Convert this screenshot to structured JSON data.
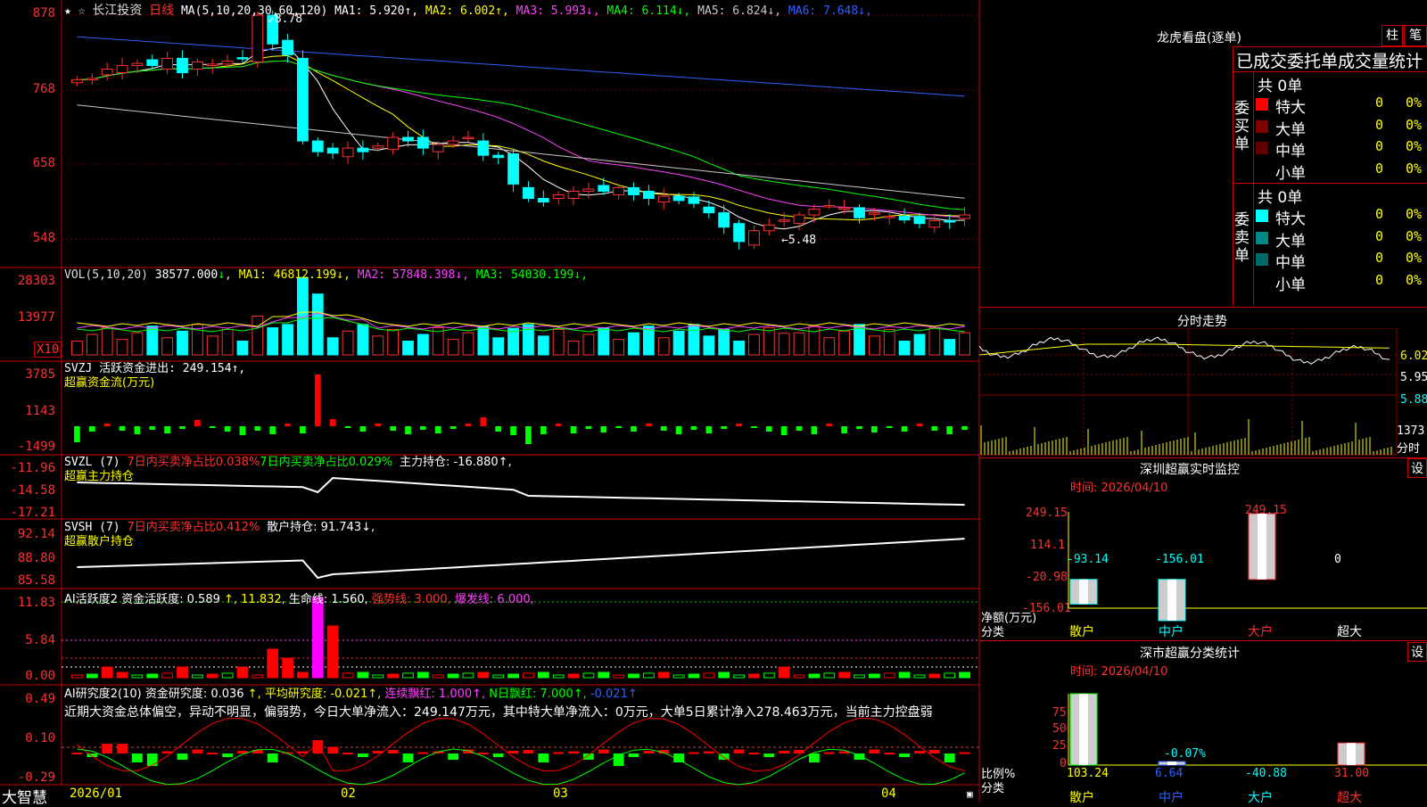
{
  "app": {
    "logo": "大智慧",
    "stock_name": "长江投资",
    "period": "日线"
  },
  "main_header": {
    "ma_label": "MA(5,10,20,30,60,120)",
    "items": [
      {
        "label": "MA1: 5.920",
        "arrow": "↑",
        "color": "#ffffff"
      },
      {
        "label": "MA2: 6.002",
        "arrow": "↑",
        "color": "#ffff00"
      },
      {
        "label": "MA3: 5.993",
        "arrow": "↓",
        "color": "#ff40ff"
      },
      {
        "label": "MA4: 6.114",
        "arrow": "↓",
        "color": "#00ff00"
      },
      {
        "label": "MA5: 6.824",
        "arrow": "↓",
        "color": "#c8c8c8"
      },
      {
        "label": "MA6: 7.648",
        "arrow": "↓",
        "color": "#3060ff"
      }
    ],
    "high_mark": "8.78",
    "low_mark": "5.48"
  },
  "vol_header": {
    "label": "VOL(5,10,20)",
    "value": "38577.000",
    "value_arrow": "↓",
    "items": [
      {
        "label": "MA1: 46812.199",
        "arrow": "↓",
        "color": "#ffff00"
      },
      {
        "label": "MA2: 57848.398",
        "arrow": "↓",
        "color": "#ff40ff"
      },
      {
        "label": "MA3: 54030.199",
        "arrow": "↓",
        "color": "#00ff00"
      }
    ],
    "unit": "X10"
  },
  "svzj_header": {
    "line1": "SVZJ  活跃资金进出: 249.154↑,",
    "line2": "超赢资金流(万元)"
  },
  "svzl_header": {
    "prefix": "SVZL (7)",
    "red1": "7日内买卖净占比0.038%",
    "green1": "7日内买卖净占比0.029%",
    "white1": "主力持仓: -16.880↑,",
    "line2": "超赢主力持仓"
  },
  "svsh_header": {
    "prefix": "SVSH (7)",
    "red1": "7日内买卖净占比0.412%",
    "white1": "散户持仓: 91.743↓,",
    "line2": "超赢散户持仓"
  },
  "ai1_header": {
    "prefix": "AI活跃度2 资金活跃度: 0.589",
    "items": [
      {
        "label": "↑, 11.832,",
        "color": "#ffff00"
      },
      {
        "label": "生命线: 1.560,",
        "color": "#ffffff"
      },
      {
        "label": "强势线: 3.000,",
        "color": "#ff3030"
      },
      {
        "label": "爆发线: 6.000,",
        "color": "#ff40ff"
      }
    ]
  },
  "ai2_header": {
    "prefix": "AI研究度2(10) 资金研究度: 0.036",
    "items": [
      {
        "label": "↑, 平均研究度: -0.021↑,",
        "color": "#ffff00"
      },
      {
        "label": "连续飘红: 1.000↑,",
        "color": "#ff40ff"
      },
      {
        "label": "N日飘红: 7.000↑,",
        "color": "#00ff00"
      },
      {
        "label": "-0.021↑",
        "color": "#3060ff"
      }
    ],
    "comment": "近期大资金总体偏空，异动不明显，偏弱势，今日大单净流入：249.147万元，其中特大单净流入：0万元，大单5日累计净入278.463万元，当前主力控盘弱"
  },
  "axes": {
    "price": [
      "878",
      "768",
      "658",
      "548"
    ],
    "vol": [
      "28303",
      "13977"
    ],
    "svzj": [
      "3785",
      "1143",
      "-1499"
    ],
    "svzl": [
      "-11.96",
      "-14.58",
      "-17.21"
    ],
    "svsh": [
      "92.14",
      "88.80",
      "85.58"
    ],
    "ai1": [
      "11.83",
      "5.84",
      "0.00"
    ],
    "ai2": [
      "0.49",
      "0.10",
      "-0.29"
    ],
    "dates": [
      "2026/01",
      "02",
      "03",
      "04"
    ]
  },
  "right_panel": {
    "title": "龙虎看盘(逐单)",
    "tab_bar": "柱",
    "tab_pen": "笔",
    "subtitle": "已成交委托单成交量统计",
    "buy_side": {
      "label": "委买单",
      "total": "共 0单",
      "rows": [
        {
          "name": "特大",
          "v1": "0",
          "v2": "0%",
          "color": "#ff0000"
        },
        {
          "name": "大单",
          "v1": "0",
          "v2": "0%",
          "color": "#800000"
        },
        {
          "name": "中单",
          "v1": "0",
          "v2": "0%",
          "color": "#600000"
        },
        {
          "name": "小单",
          "v1": "0",
          "v2": "0%",
          "color": "#000000"
        }
      ]
    },
    "sell_side": {
      "label": "委卖单",
      "total": "共 0单",
      "rows": [
        {
          "name": "特大",
          "v1": "0",
          "v2": "0%",
          "color": "#00ffff"
        },
        {
          "name": "大单",
          "v1": "0",
          "v2": "0%",
          "color": "#008888"
        },
        {
          "name": "中单",
          "v1": "0",
          "v2": "0%",
          "color": "#006a6a"
        },
        {
          "name": "小单",
          "v1": "0",
          "v2": "0%",
          "color": "#000000"
        }
      ]
    },
    "intraday": {
      "title": "分时走势",
      "p1": "6.02",
      "p2": "5.95",
      "p3": "5.88",
      "vol": "1373",
      "vol_unit": "分时"
    },
    "monitor": {
      "title": "深圳超赢实时监控",
      "settings": "设",
      "time": "时间: 2026/04/10",
      "ylabels": [
        "249.15",
        "114.1",
        "-20.98",
        "-156.01"
      ],
      "yunit": "净额(万元)",
      "xunit": "分类"
    },
    "stats": {
      "title": "深市超赢分类统计",
      "settings": "设",
      "time": "时间: 2026/04/10",
      "ylabels": [
        "75",
        "50",
        "25",
        "0"
      ],
      "yunit": "比例%",
      "xunit": "分类"
    }
  },
  "chart_data": [
    {
      "type": "bar",
      "title": "深圳超赢实时监控",
      "ylabel": "净额(万元)",
      "xlabel": "分类",
      "categories": [
        "散户",
        "中户",
        "大户",
        "超大"
      ],
      "values": [
        -93.14,
        -156.01,
        249.15,
        0
      ],
      "value_labels": [
        "-93.14",
        "-156.01",
        "249.15",
        "0"
      ],
      "ylim": [
        -156.01,
        249.15
      ]
    },
    {
      "type": "bar",
      "title": "深市超赢分类统计",
      "ylabel": "比例%",
      "xlabel": "分类",
      "categories": [
        "散户",
        "中户",
        "大户",
        "超大"
      ],
      "values": [
        103.24,
        6.64,
        -40.88,
        31.0
      ],
      "value_labels": [
        "103.24",
        "6.64",
        "-40.88",
        "31.00"
      ],
      "top_labels": [
        "",
        "-0.07%",
        "",
        ""
      ],
      "ylim": [
        0,
        100
      ]
    },
    {
      "type": "candlestick",
      "title": "长江投资 日线",
      "ylim": [
        5.25,
        8.85
      ],
      "high": 8.78,
      "low": 5.48,
      "close_series": [
        7.8,
        7.82,
        7.95,
        8.0,
        8.03,
        8.0,
        8.1,
        7.9,
        8.05,
        8.02,
        8.06,
        8.1,
        8.7,
        8.3,
        8.15,
        6.95,
        6.8,
        6.78,
        6.85,
        6.8,
        6.88,
        7.0,
        6.95,
        6.85,
        6.9,
        6.95,
        7.0,
        6.75,
        6.72,
        6.35,
        6.15,
        6.1,
        6.2,
        6.25,
        6.28,
        6.25,
        6.3,
        6.2,
        6.15,
        6.18,
        6.12,
        6.08,
        5.95,
        5.75,
        5.55,
        5.7,
        5.78,
        5.85,
        5.92,
        6.0,
        6.05,
        6.02,
        5.88,
        5.95,
        5.9,
        5.85,
        5.8,
        5.84,
        5.82,
        5.92
      ]
    }
  ]
}
